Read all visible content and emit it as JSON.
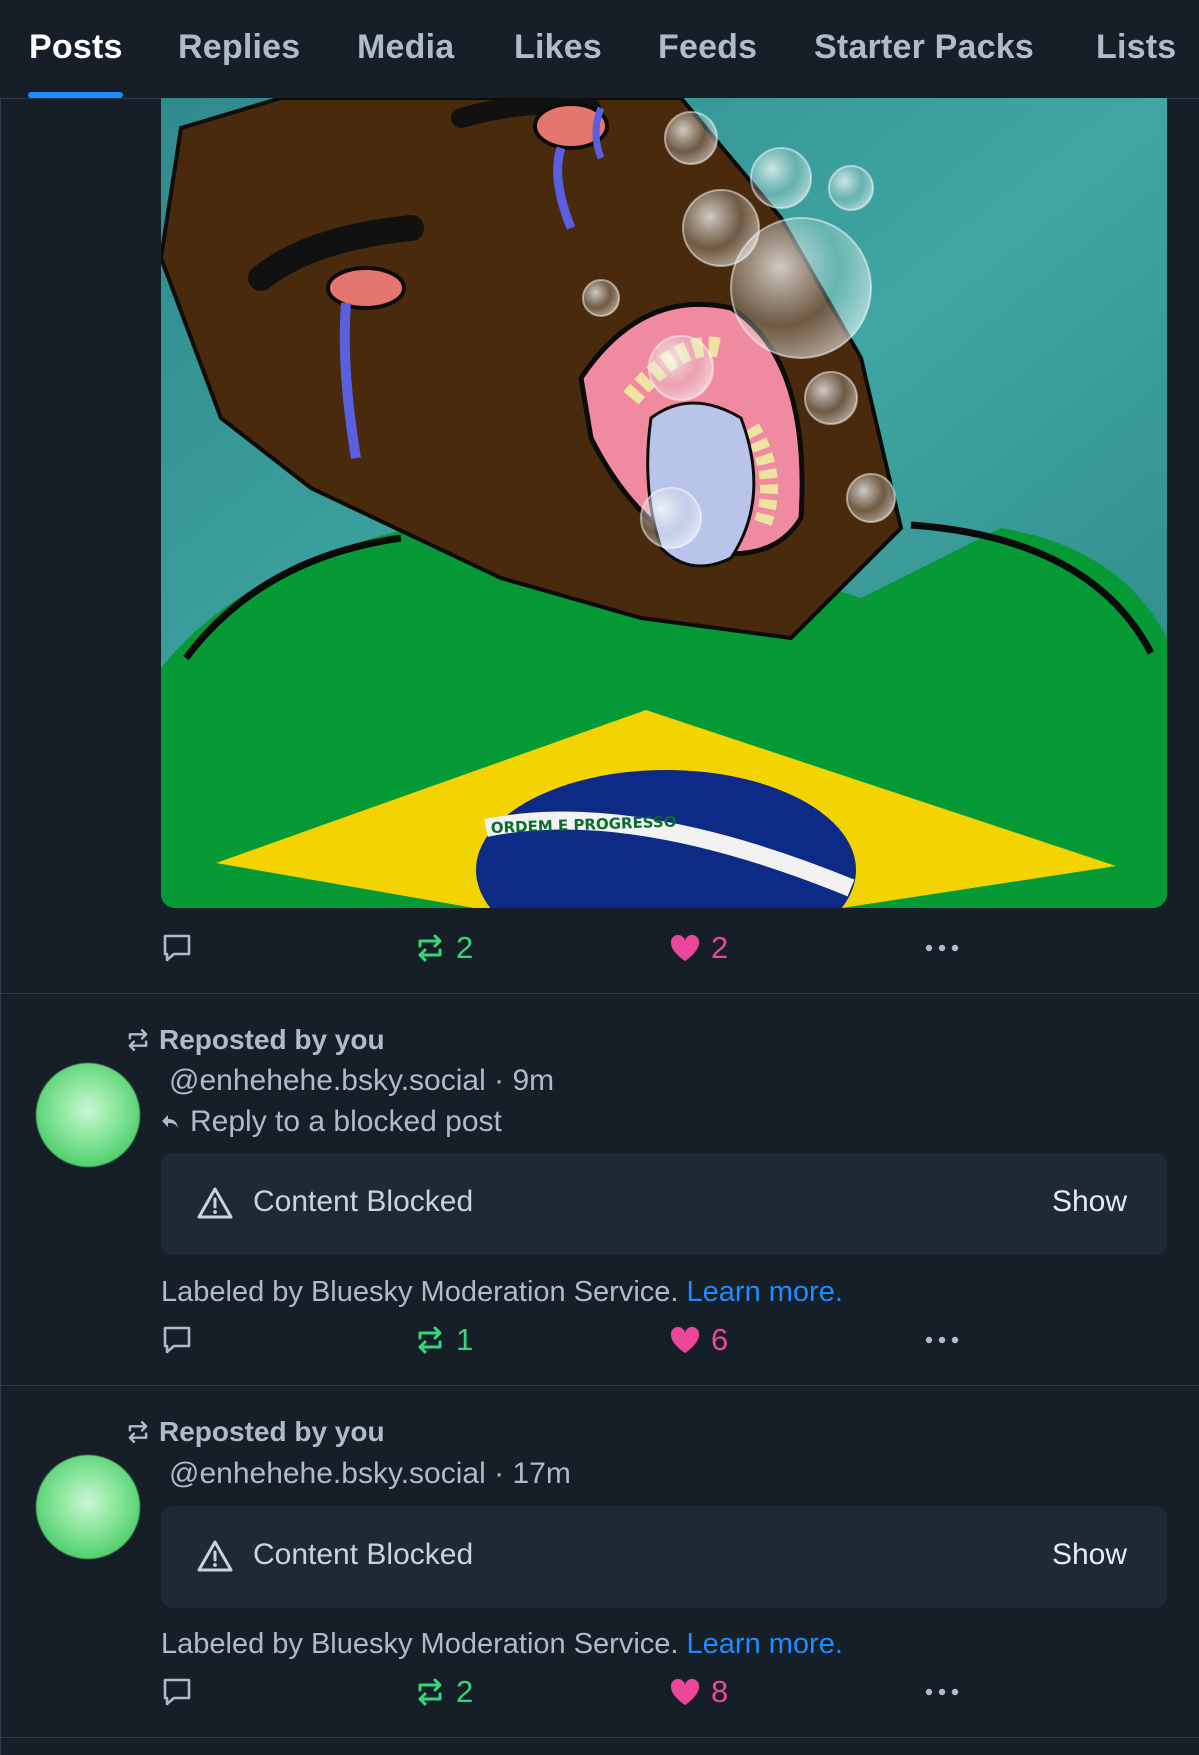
{
  "tabs": [
    {
      "label": "Posts",
      "active": true
    },
    {
      "label": "Replies",
      "active": false
    },
    {
      "label": "Media",
      "active": false
    },
    {
      "label": "Likes",
      "active": false
    },
    {
      "label": "Feeds",
      "active": false
    },
    {
      "label": "Starter Packs",
      "active": false
    },
    {
      "label": "Lists",
      "active": false
    }
  ],
  "post_image": {
    "description_icon": "crying-face-brazil-flag-drawing",
    "flag_motto": "ORDEM E PROGRESSO"
  },
  "posts": [
    {
      "reply_count": "",
      "repost_count": "2",
      "like_count": "2"
    },
    {
      "repost_label": "Reposted by you",
      "handle": "@enhehehe.bsky.social",
      "separator": "·",
      "time": "9m",
      "reply_to": "Reply to a blocked post",
      "blocked_label": "Content Blocked",
      "show_label": "Show",
      "moderation_note": "Labeled by Bluesky Moderation Service.",
      "learn_more": "Learn more.",
      "repost_count": "1",
      "like_count": "6"
    },
    {
      "repost_label": "Reposted by you",
      "handle": "@enhehehe.bsky.social",
      "separator": "·",
      "time": "17m",
      "blocked_label": "Content Blocked",
      "show_label": "Show",
      "moderation_note": "Labeled by Bluesky Moderation Service.",
      "learn_more": "Learn more.",
      "repost_count": "2",
      "like_count": "8"
    }
  ],
  "colors": {
    "background": "#161e27",
    "accent": "#208bfe",
    "repost_green": "#37d67a",
    "like_pink": "#ec4899"
  }
}
